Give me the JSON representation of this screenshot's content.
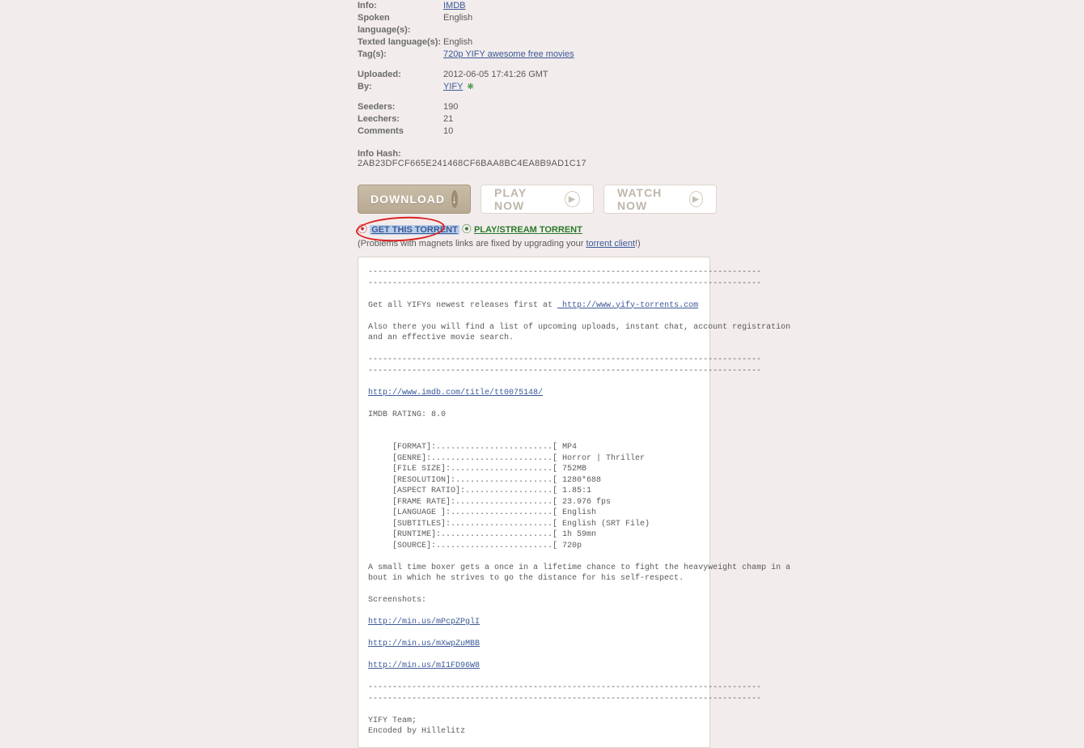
{
  "info": {
    "infoLabel": "Info:",
    "infoValue": "IMDB",
    "spokenLabel": "Spoken language(s):",
    "spokenValue": "English",
    "textedLabel": "Texted language(s):",
    "textedValue": "English",
    "tagsLabel": "Tag(s):",
    "tagsValue": "720p YIFY awesome free movies",
    "uploadedLabel": "Uploaded:",
    "uploadedValue": "2012-06-05 17:41:26 GMT",
    "byLabel": "By:",
    "byValue": "YIFY",
    "seedersLabel": "Seeders:",
    "seedersValue": "190",
    "leechersLabel": "Leechers:",
    "leechersValue": "21",
    "commentsLabel": "Comments",
    "commentsValue": "10",
    "infoHashLabel": "Info Hash:",
    "infoHashValue": "2AB23DFCF665E241468CF6BAA8BC4EA8B9AD1C17"
  },
  "buttons": {
    "download": "DOWNLOAD",
    "playNow": "PLAY NOW",
    "watchNow": "WATCH NOW"
  },
  "links": {
    "getTorrent": "GET THIS TORRENT",
    "playStream": "PLAY/STREAM TORRENT",
    "problemsPrefix": "(Problems with magnets links are fixed by upgrading your ",
    "torrentClient": "torrent client",
    "problemsSuffix": "!)"
  },
  "desc": {
    "sep": "---------------------------------------------------------------------------------",
    "getAll": "Get all YIFYs newest releases first at ",
    "yifyUrl": " http://www.yify-torrents.com",
    "alsoLine1": "Also there you will find a list of upcoming uploads, instant chat, account registration",
    "alsoLine2": "and an effective movie search.",
    "imdbUrl": "http://www.imdb.com/title/tt0075148/",
    "rating": "IMDB RATING: 8.0",
    "specs": "     [FORMAT]:........................[ MP4\n     [GENRE]:.........................[ Horror | Thriller\n     [FILE SIZE]:.....................[ 752MB\n     [RESOLUTION]:....................[ 1280*688\n     [ASPECT RATIO]:..................[ 1.85:1\n     [FRAME RATE]:....................[ 23.976 fps\n     [LANGUAGE ]:.....................[ English\n     [SUBTITLES]:.....................[ English (SRT File)\n     [RUNTIME]:.......................[ 1h 59mn\n     [SOURCE]:........................[ 720p",
    "synopsis1": "A small time boxer gets a once in a lifetime chance to fight the heavyweight champ in a",
    "synopsis2": "bout in which he strives to go the distance for his self-respect.",
    "screenshotsLabel": "Screenshots:",
    "ss1": "http://min.us/mPcpZPglI",
    "ss2": "http://min.us/mXwpZuMBB",
    "ss3": "http://min.us/mI1FD96W8",
    "team": "YIFY Team;",
    "encoded": "Encoded by Hillelitz"
  }
}
